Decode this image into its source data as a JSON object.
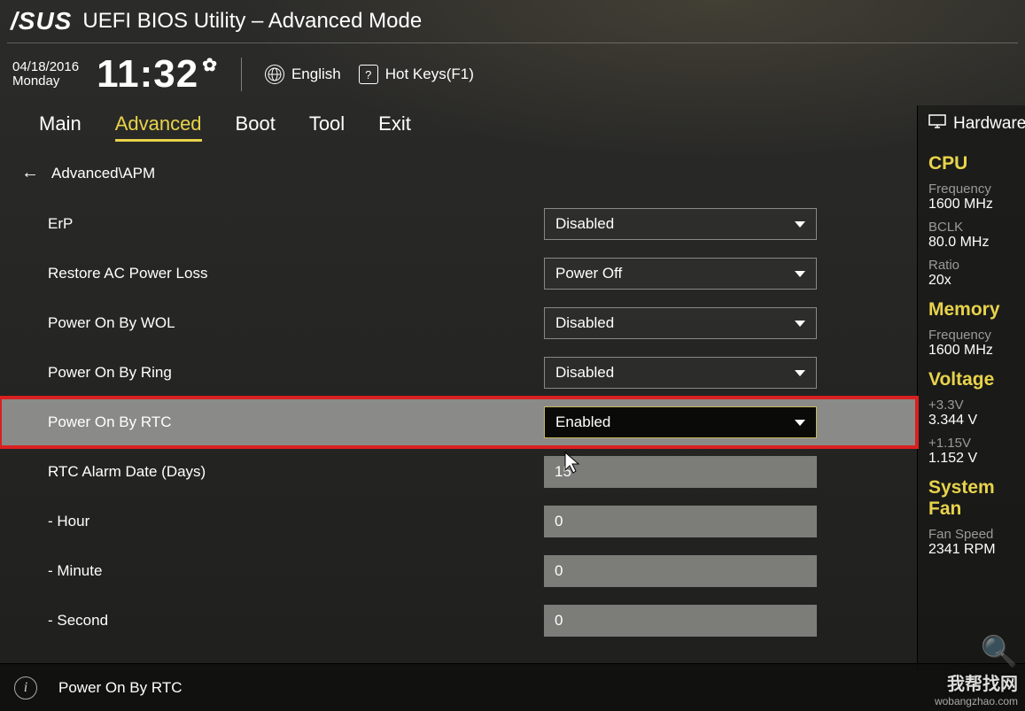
{
  "header": {
    "logo": "/SUS",
    "title": "UEFI BIOS Utility – Advanced Mode",
    "date": "04/18/2016",
    "day": "Monday",
    "time": "11:32",
    "language_label": "English",
    "hotkeys_label": "Hot Keys(F1)"
  },
  "tabs": [
    "Main",
    "Advanced",
    "Boot",
    "Tool",
    "Exit"
  ],
  "active_tab": "Advanced",
  "breadcrumb": "Advanced\\APM",
  "settings": [
    {
      "label": "ErP",
      "type": "select",
      "value": "Disabled"
    },
    {
      "label": "Restore AC Power Loss",
      "type": "select",
      "value": "Power Off"
    },
    {
      "label": "Power On By WOL",
      "type": "select",
      "value": "Disabled"
    },
    {
      "label": "Power On By Ring",
      "type": "select",
      "value": "Disabled"
    },
    {
      "label": "Power On By RTC",
      "type": "select",
      "value": "Enabled",
      "highlight": true
    },
    {
      "label": "RTC Alarm Date (Days)",
      "type": "text",
      "value": "15",
      "cursor": true
    },
    {
      "label": " - Hour",
      "type": "text",
      "value": "0"
    },
    {
      "label": " - Minute",
      "type": "text",
      "value": "0"
    },
    {
      "label": " - Second",
      "type": "text",
      "value": "0"
    }
  ],
  "sidebar": {
    "title": "Hardware",
    "groups": [
      {
        "heading": "CPU",
        "items": [
          {
            "label": "Frequency",
            "value": "1600 MHz"
          },
          {
            "label": "BCLK",
            "value": "80.0 MHz"
          },
          {
            "label": "Ratio",
            "value": "20x"
          }
        ]
      },
      {
        "heading": "Memory",
        "items": [
          {
            "label": "Frequency",
            "value": "1600 MHz"
          }
        ]
      },
      {
        "heading": "Voltage",
        "items": [
          {
            "label": "+3.3V",
            "value": "3.344 V"
          },
          {
            "label": "+1.15V",
            "value": "1.152 V"
          }
        ]
      },
      {
        "heading": "System Fan",
        "items": [
          {
            "label": "Fan Speed",
            "value": "2341 RPM"
          }
        ]
      }
    ]
  },
  "footer": {
    "help_text": "Power On By RTC"
  },
  "watermark": {
    "text": "我帮找网",
    "url": "wobangzhao.com"
  }
}
